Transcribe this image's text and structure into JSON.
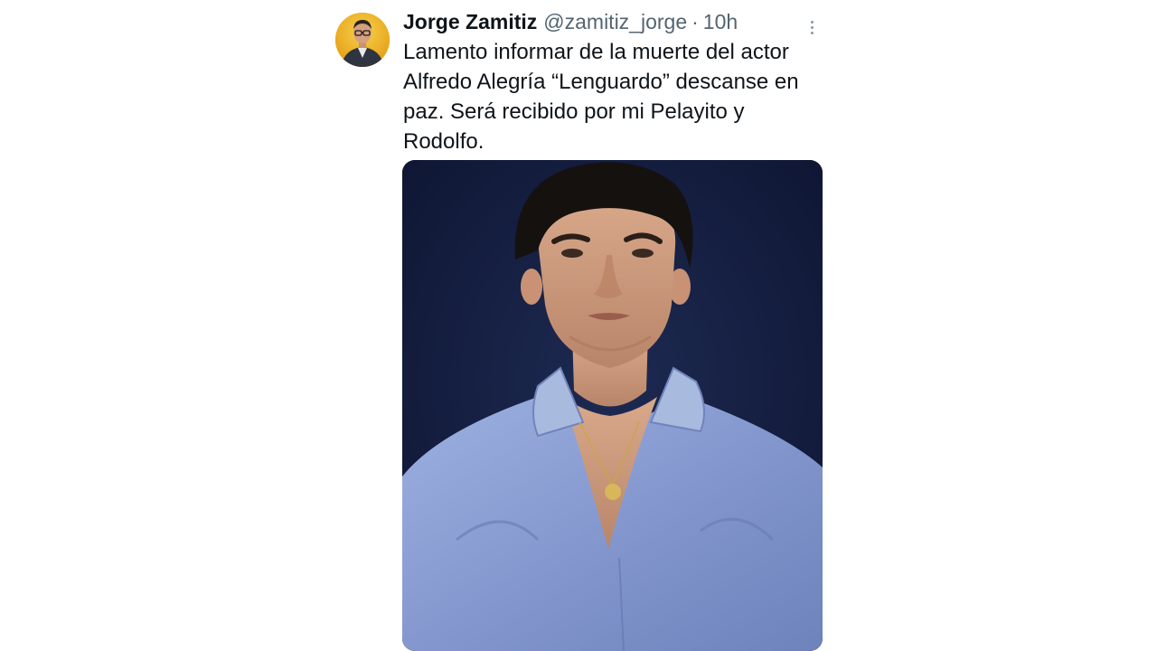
{
  "tweet": {
    "author": {
      "display_name": "Jorge Zamitiz",
      "handle": "@zamitiz_jorge",
      "avatar_icon": "user-avatar"
    },
    "separator": "·",
    "time": "10h",
    "more_icon": "more-vertical-icon",
    "text": "Lamento informar de la muerte del actor Alfredo Alegría “Lenguardo” descanse en paz. Será recibido por mi Pelayito y Rodolfo.",
    "media": {
      "type": "photo",
      "icon": "photo-portrait"
    }
  },
  "colors": {
    "primary_text": "#0f1419",
    "secondary_text": "#536471",
    "background": "#ffffff",
    "photo_background": "#141b38"
  }
}
